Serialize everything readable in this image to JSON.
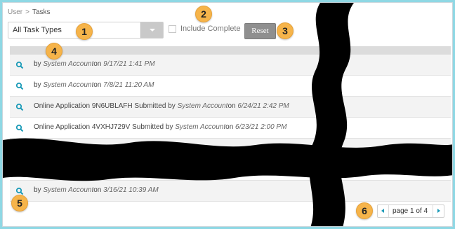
{
  "breadcrumb": {
    "parent": "User",
    "separator": ">",
    "current": "Tasks"
  },
  "filters": {
    "task_type_selected": "All Task Types",
    "include_complete_label": "Include Complete",
    "include_complete_checked": false,
    "reset_label": "Reset"
  },
  "tasks": [
    {
      "prefix": "",
      "by": "by",
      "user": "System Account",
      "on": "on",
      "date": "9/17/21 1:41 PM"
    },
    {
      "prefix": "",
      "by": "by",
      "user": "System Account",
      "on": "on",
      "date": "7/8/21 11:20 AM"
    },
    {
      "prefix": "Online Application 9N6UBLAFH Submitted",
      "by": "by",
      "user": "System Account",
      "on": "on",
      "date": "6/24/21 2:42 PM"
    },
    {
      "prefix": "Online Application 4VXHJ729V Submitted",
      "by": "by",
      "user": "System Account",
      "on": "on",
      "date": "6/23/21 2:00 PM"
    },
    {
      "prefix": "",
      "by": "by",
      "user": "System Account",
      "on": "on",
      "date": "3/16/21 10:39 AM"
    }
  ],
  "pagination": {
    "label": "page 1 of 4"
  },
  "callouts": [
    "1",
    "2",
    "3",
    "4",
    "5",
    "6"
  ],
  "colors": {
    "accent": "#1a9ab7",
    "callout": "#f6b44a",
    "background": "#8fd8e4"
  },
  "icons": {
    "row_icon": "magnifier-icon"
  }
}
